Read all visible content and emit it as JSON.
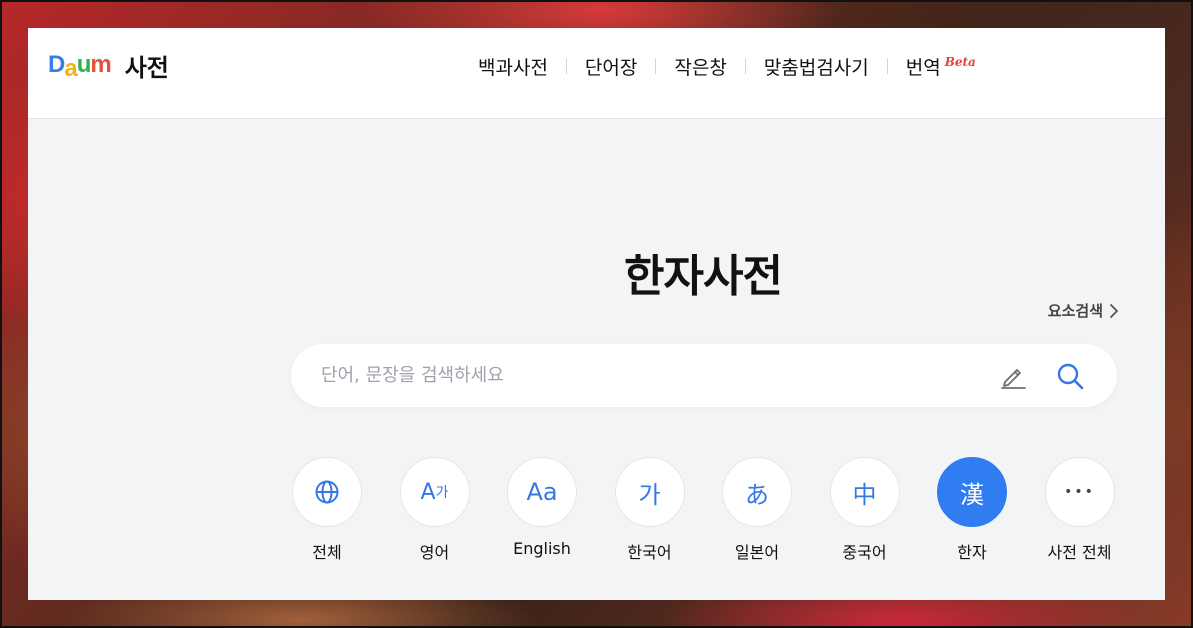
{
  "logo": {
    "brand_letters": [
      "D",
      "a",
      "u",
      "m"
    ],
    "service": "사전"
  },
  "nav": {
    "items": [
      {
        "label": "백과사전"
      },
      {
        "label": "단어장"
      },
      {
        "label": "작은창"
      },
      {
        "label": "맞춤법검사기"
      },
      {
        "label": "번역"
      }
    ],
    "beta_badge": "Beta"
  },
  "page_title": "한자사전",
  "element_search": {
    "label": "요소검색"
  },
  "search": {
    "placeholder": "단어, 문장을 검색하세요",
    "value": "",
    "handwriting_icon": "pen-icon",
    "search_icon": "search-icon"
  },
  "categories": [
    {
      "label": "전체",
      "icon": "globe-icon",
      "glyph": ""
    },
    {
      "label": "영어",
      "icon": "a-ga-icon",
      "glyph_main": "A",
      "glyph_sub": "가"
    },
    {
      "label": "English",
      "icon": "aa-icon",
      "glyph": "Aa"
    },
    {
      "label": "한국어",
      "icon": "ga-icon",
      "glyph": "가"
    },
    {
      "label": "일본어",
      "icon": "hiragana-a-icon",
      "glyph": "あ"
    },
    {
      "label": "중국어",
      "icon": "zhong-icon",
      "glyph": "中"
    },
    {
      "label": "한자",
      "icon": "han-icon",
      "glyph": "漢",
      "active": true
    },
    {
      "label": "사전 전체",
      "icon": "more-icon",
      "glyph": "•••"
    }
  ],
  "colors": {
    "accent": "#2f7df0",
    "icon_blue": "#3578e5",
    "panel_bg": "#f3f4f6",
    "beta_red": "#e8403c"
  }
}
